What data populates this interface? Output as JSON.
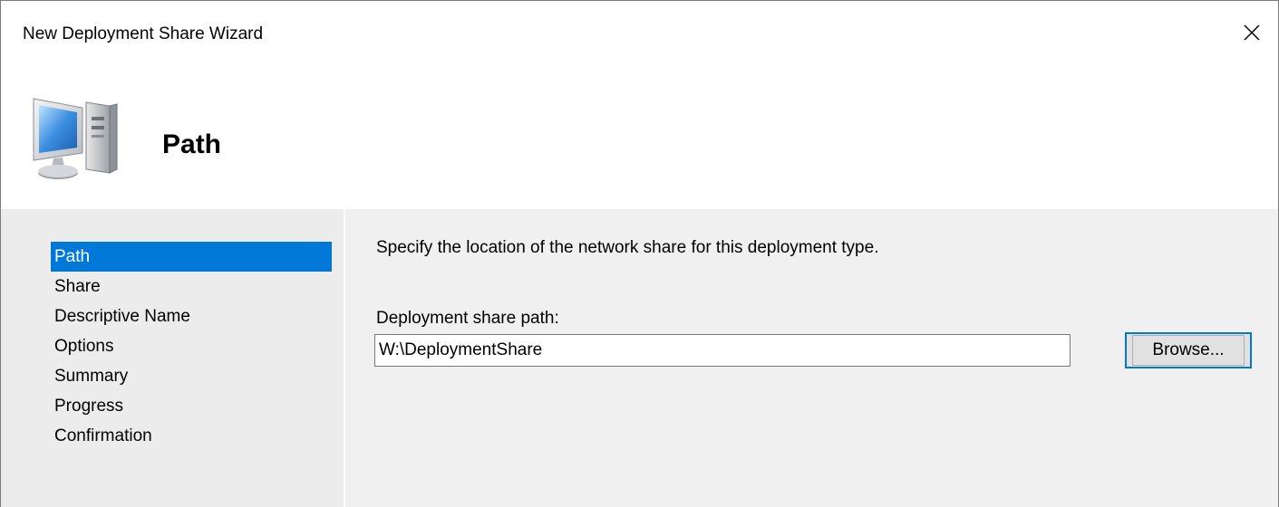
{
  "window": {
    "title": "New Deployment Share Wizard"
  },
  "header": {
    "page_title": "Path",
    "icon": "computer-icon"
  },
  "sidebar": {
    "steps": [
      {
        "label": "Path",
        "active": true
      },
      {
        "label": "Share",
        "active": false
      },
      {
        "label": "Descriptive Name",
        "active": false
      },
      {
        "label": "Options",
        "active": false
      },
      {
        "label": "Summary",
        "active": false
      },
      {
        "label": "Progress",
        "active": false
      },
      {
        "label": "Confirmation",
        "active": false
      }
    ]
  },
  "main": {
    "instruction": "Specify the location of the network share for this deployment type.",
    "path_label": "Deployment share path:",
    "path_value": "W:\\DeploymentShare",
    "browse_label": "Browse..."
  },
  "colors": {
    "selection": "#0078d7",
    "sidebar_bg": "#ececec",
    "content_bg": "#f0f0f0"
  }
}
